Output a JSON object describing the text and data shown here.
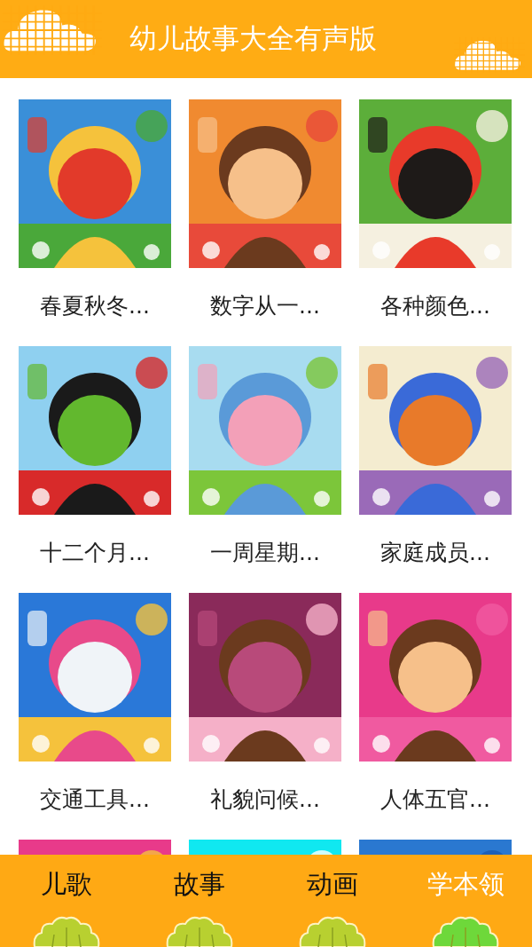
{
  "header": {
    "title": "幼儿故事大全有声版"
  },
  "tiles": [
    {
      "kind": "picture",
      "title": "春夏秋冬..."
    },
    {
      "kind": "picture",
      "title": "数字从一..."
    },
    {
      "kind": "picture",
      "title": "各种颜色..."
    },
    {
      "kind": "picture",
      "title": "十二个月..."
    },
    {
      "kind": "picture",
      "title": "一周星期..."
    },
    {
      "kind": "picture",
      "title": "家庭成员..."
    },
    {
      "kind": "picture",
      "title": "交通工具..."
    },
    {
      "kind": "picture",
      "title": "礼貌问候..."
    },
    {
      "kind": "picture",
      "title": "人体五官..."
    },
    {
      "kind": "picture"
    },
    {
      "kind": "picture"
    },
    {
      "kind": "picture"
    }
  ],
  "tabs": [
    {
      "label": "儿歌",
      "selected": false
    },
    {
      "label": "故事",
      "selected": false
    },
    {
      "label": "动画",
      "selected": false
    },
    {
      "label": "学本领",
      "selected": true
    }
  ]
}
